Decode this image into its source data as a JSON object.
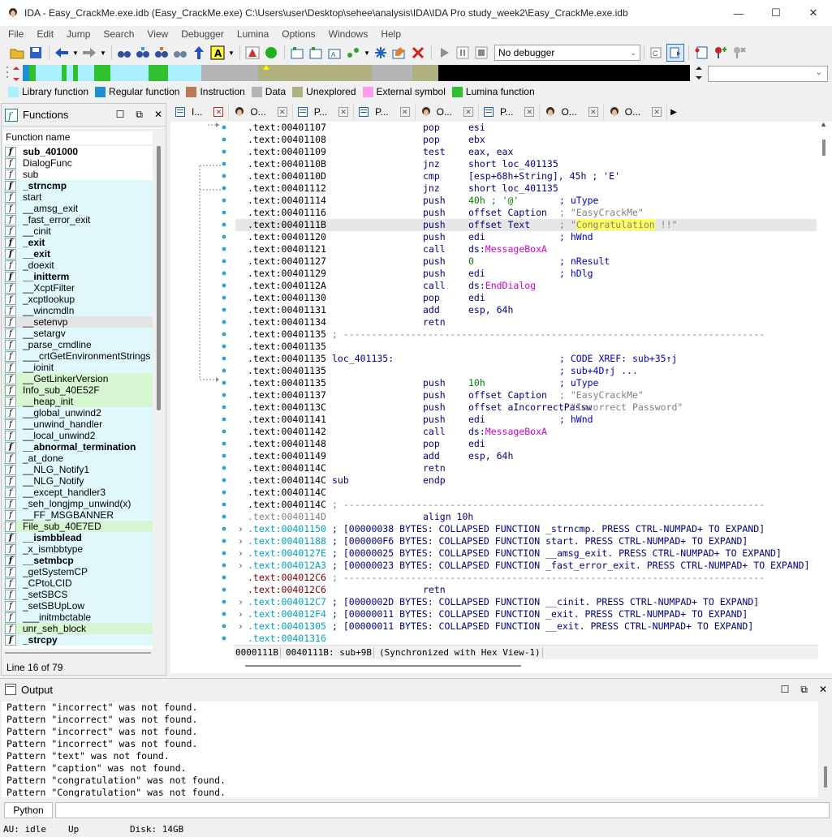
{
  "window": {
    "title": "IDA - Easy_CrackMe.exe.idb (Easy_CrackMe.exe) C:\\Users\\user\\Desktop\\sehee\\analysis\\IDA\\IDA Pro study_week2\\Easy_CrackMe.exe.idb",
    "minimize": "—",
    "maximize": "☐",
    "close": "✕"
  },
  "menu": [
    "File",
    "Edit",
    "Jump",
    "Search",
    "View",
    "Debugger",
    "Lumina",
    "Options",
    "Windows",
    "Help"
  ],
  "toolbar": {
    "debugger_value": "No debugger"
  },
  "legend": [
    {
      "label": "Library function",
      "color": "#aaf0ff"
    },
    {
      "label": "Regular function",
      "color": "#1e90d0"
    },
    {
      "label": "Instruction",
      "color": "#b97a57"
    },
    {
      "label": "Data",
      "color": "#b4b4b4"
    },
    {
      "label": "Unexplored",
      "color": "#b0b080"
    },
    {
      "label": "External symbol",
      "color": "#ff9cf0"
    },
    {
      "label": "Lumina function",
      "color": "#30c030"
    }
  ],
  "colors": {
    "library": "#e0f7fb",
    "lumina": "#d6f5d1",
    "addr_collapsed": "#00a0c0",
    "comment": "#0000c0",
    "api": "#d000d0",
    "string": "#808080",
    "highlight": "#ffff60"
  },
  "functions": {
    "title": "Functions",
    "column_header": "Function name",
    "status": "Line 16 of 79",
    "items": [
      {
        "name": "sub_401000",
        "style": "bold"
      },
      {
        "name": "DialogFunc",
        "style": "normal"
      },
      {
        "name": "sub",
        "style": "normal"
      },
      {
        "name": "_strncmp",
        "style": "lib bold"
      },
      {
        "name": "start",
        "style": "lib"
      },
      {
        "name": "__amsg_exit",
        "style": "lib"
      },
      {
        "name": "_fast_error_exit",
        "style": "lib"
      },
      {
        "name": "__cinit",
        "style": "lib"
      },
      {
        "name": "_exit",
        "style": "lib bold"
      },
      {
        "name": "__exit",
        "style": "lib bold"
      },
      {
        "name": "_doexit",
        "style": "lib"
      },
      {
        "name": "__initterm",
        "style": "lib bold"
      },
      {
        "name": "__XcptFilter",
        "style": "lib"
      },
      {
        "name": "_xcptlookup",
        "style": "lib"
      },
      {
        "name": "__wincmdln",
        "style": "lib"
      },
      {
        "name": "__setenvp",
        "style": "sel"
      },
      {
        "name": "__setargv",
        "style": "lib"
      },
      {
        "name": "_parse_cmdline",
        "style": "lib"
      },
      {
        "name": "___crtGetEnvironmentStrings",
        "style": "lib"
      },
      {
        "name": "__ioinit",
        "style": "lib"
      },
      {
        "name": "__GetLinkerVersion",
        "style": "lumina"
      },
      {
        "name": "Info_sub_40E52F",
        "style": "lumina"
      },
      {
        "name": "__heap_init",
        "style": "lumina"
      },
      {
        "name": "__global_unwind2",
        "style": "lib"
      },
      {
        "name": "__unwind_handler",
        "style": "lib"
      },
      {
        "name": "__local_unwind2",
        "style": "lib"
      },
      {
        "name": "__abnormal_termination",
        "style": "lib bold"
      },
      {
        "name": "_at_done",
        "style": "lib"
      },
      {
        "name": "__NLG_Notify1",
        "style": "lib"
      },
      {
        "name": "__NLG_Notify",
        "style": "lib"
      },
      {
        "name": "__except_handler3",
        "style": "lib"
      },
      {
        "name": "_seh_longjmp_unwind(x)",
        "style": "lib"
      },
      {
        "name": "__FF_MSGBANNER",
        "style": "lib"
      },
      {
        "name": "File_sub_40E7ED",
        "style": "lumina"
      },
      {
        "name": "__ismbblead",
        "style": "lib bold"
      },
      {
        "name": "_x_ismbbtype",
        "style": "lib"
      },
      {
        "name": "__setmbcp",
        "style": "lib bold"
      },
      {
        "name": "_getSystemCP",
        "style": "lib"
      },
      {
        "name": "_CPtoLCID",
        "style": "lib"
      },
      {
        "name": "_setSBCS",
        "style": "lib"
      },
      {
        "name": "_setSBUpLow",
        "style": "lib"
      },
      {
        "name": "___initmbctable",
        "style": "lib"
      },
      {
        "name": "unr_seh_block",
        "style": "lumina"
      },
      {
        "name": "_strcpy",
        "style": "lib bold"
      }
    ]
  },
  "tabs": [
    {
      "label": "I...",
      "icon": "ida-view-icon",
      "active": true
    },
    {
      "label": "O...",
      "icon": "person-icon"
    },
    {
      "label": "P...",
      "icon": "ida-view-icon"
    },
    {
      "label": "P...",
      "icon": "ida-view-icon"
    },
    {
      "label": "O...",
      "icon": "person-icon"
    },
    {
      "label": "P...",
      "icon": "ida-view-icon"
    },
    {
      "label": "O...",
      "icon": "person-icon"
    },
    {
      "label": "O...",
      "icon": "person-icon"
    }
  ],
  "disasm": [
    {
      "addr": ".text:00401107",
      "mn": "pop",
      "op": "esi"
    },
    {
      "addr": ".text:00401108",
      "mn": "pop",
      "op": "ebx"
    },
    {
      "addr": ".text:00401109",
      "mn": "test",
      "op": "eax, eax"
    },
    {
      "addr": ".text:0040110B",
      "mn": "jnz",
      "op": "short loc_401135"
    },
    {
      "addr": ".text:0040110D",
      "mn": "cmp",
      "op": "[esp+68h+String], 45h ; 'E'"
    },
    {
      "addr": ".text:00401112",
      "mn": "jnz",
      "op": "short loc_401135"
    },
    {
      "addr": ".text:00401114",
      "mn": "push",
      "op": "40h ; '@'",
      "cm": "; uType"
    },
    {
      "addr": ".text:00401116",
      "mn": "push",
      "op": "offset Caption",
      "cm": "; \"EasyCrackMe\""
    },
    {
      "addr": ".text:0040111B",
      "mn": "push",
      "op": "offset Text",
      "cm_pre": "; \"",
      "cm_hl": "Congratulation",
      "cm_post": " !!\"",
      "highlight": true
    },
    {
      "addr": ".text:00401120",
      "mn": "push",
      "op": "edi",
      "cm": "; hWnd"
    },
    {
      "addr": ".text:00401121",
      "mn": "call",
      "op_pre": "ds:",
      "op_api": "MessageBoxA"
    },
    {
      "addr": ".text:00401127",
      "mn": "push",
      "op": "0",
      "cm": "; nResult"
    },
    {
      "addr": ".text:00401129",
      "mn": "push",
      "op": "edi",
      "cm": "; hDlg"
    },
    {
      "addr": ".text:0040112A",
      "mn": "call",
      "op_pre": "ds:",
      "op_api": "EndDialog"
    },
    {
      "addr": ".text:00401130",
      "mn": "pop",
      "op": "edi"
    },
    {
      "addr": ".text:00401131",
      "mn": "add",
      "op": "esp, 64h"
    },
    {
      "addr": ".text:00401134",
      "mn": "retn"
    },
    {
      "addr": ".text:00401135",
      "sep": "; ---------------------------------------------------------------------------"
    },
    {
      "addr": ".text:00401135"
    },
    {
      "addr": ".text:00401135",
      "label": "loc_401135:",
      "cm": "; CODE XREF: sub+35↑j"
    },
    {
      "addr": ".text:00401135",
      "cm": "; sub+4D↑j ..."
    },
    {
      "addr": ".text:00401135",
      "mn": "push",
      "op": "10h",
      "cm": "; uType"
    },
    {
      "addr": ".text:00401137",
      "mn": "push",
      "op": "offset Caption",
      "cm": "; \"EasyCrackMe\""
    },
    {
      "addr": ".text:0040113C",
      "mn": "push",
      "op": "offset aIncorrectPassw",
      "cm": "; \"Incorrect Password\""
    },
    {
      "addr": ".text:00401141",
      "mn": "push",
      "op": "edi",
      "cm": "; hWnd"
    },
    {
      "addr": ".text:00401142",
      "mn": "call",
      "op_pre": "ds:",
      "op_api": "MessageBoxA"
    },
    {
      "addr": ".text:00401148",
      "mn": "pop",
      "op": "edi"
    },
    {
      "addr": ".text:00401149",
      "mn": "add",
      "op": "esp, 64h"
    },
    {
      "addr": ".text:0040114C",
      "mn": "retn"
    },
    {
      "addr": ".text:0040114C",
      "label": "sub",
      "mn": "endp"
    },
    {
      "addr": ".text:0040114C"
    },
    {
      "addr": ".text:0040114C",
      "sep": "; ---------------------------------------------------------------------------"
    },
    {
      "addr": ".text:0040114D",
      "mn": "align 10h",
      "addrstyle": "grey"
    },
    {
      "addr": ".text:00401150",
      "collapsed": "; [00000038 BYTES: COLLAPSED FUNCTION _strncmp. PRESS CTRL-NUMPAD+ TO EXPAND]"
    },
    {
      "addr": ".text:00401188",
      "collapsed": "; [000000F6 BYTES: COLLAPSED FUNCTION start. PRESS CTRL-NUMPAD+ TO EXPAND]"
    },
    {
      "addr": ".text:0040127E",
      "collapsed": "; [00000025 BYTES: COLLAPSED FUNCTION __amsg_exit. PRESS CTRL-NUMPAD+ TO EXPAND]"
    },
    {
      "addr": ".text:004012A3",
      "collapsed": "; [00000023 BYTES: COLLAPSED FUNCTION _fast_error_exit. PRESS CTRL-NUMPAD+ TO EXPAND]"
    },
    {
      "addr": ".text:004012C6",
      "sep": "; ---------------------------------------------------------------------------",
      "addrstyle": "dark"
    },
    {
      "addr": ".text:004012C6",
      "mn": "retn",
      "addrstyle": "dark"
    },
    {
      "addr": ".text:004012C7",
      "collapsed": "; [0000002D BYTES: COLLAPSED FUNCTION __cinit. PRESS CTRL-NUMPAD+ TO EXPAND]"
    },
    {
      "addr": ".text:004012F4",
      "collapsed": "; [00000011 BYTES: COLLAPSED FUNCTION _exit. PRESS CTRL-NUMPAD+ TO EXPAND]"
    },
    {
      "addr": ".text:00401305",
      "collapsed": "; [00000011 BYTES: COLLAPSED FUNCTION __exit. PRESS CTRL-NUMPAD+ TO EXPAND]"
    },
    {
      "addr": ".text:00401316",
      "addrstyle": "collapsed"
    }
  ],
  "view_status": {
    "offset": "0000111B",
    "location": "0040111B: sub+9B",
    "sync": "(Synchronized with Hex View-1)"
  },
  "output": {
    "title": "Output",
    "lines": [
      "Pattern \"incorrect\" was not found.",
      "Pattern \"incorrect\" was not found.",
      "Pattern \"incorrect\" was not found.",
      "Pattern \"incorrect\" was not found.",
      "Pattern \"text\" was not found.",
      "Pattern \"caption\" was not found.",
      "Pattern \"congratulation\" was not found.",
      "Pattern \"Congratulation\" was not found."
    ],
    "python_button": "Python"
  },
  "statusbar": {
    "au": "AU:  idle",
    "mode": "Up",
    "disk": "Disk: 14GB"
  }
}
